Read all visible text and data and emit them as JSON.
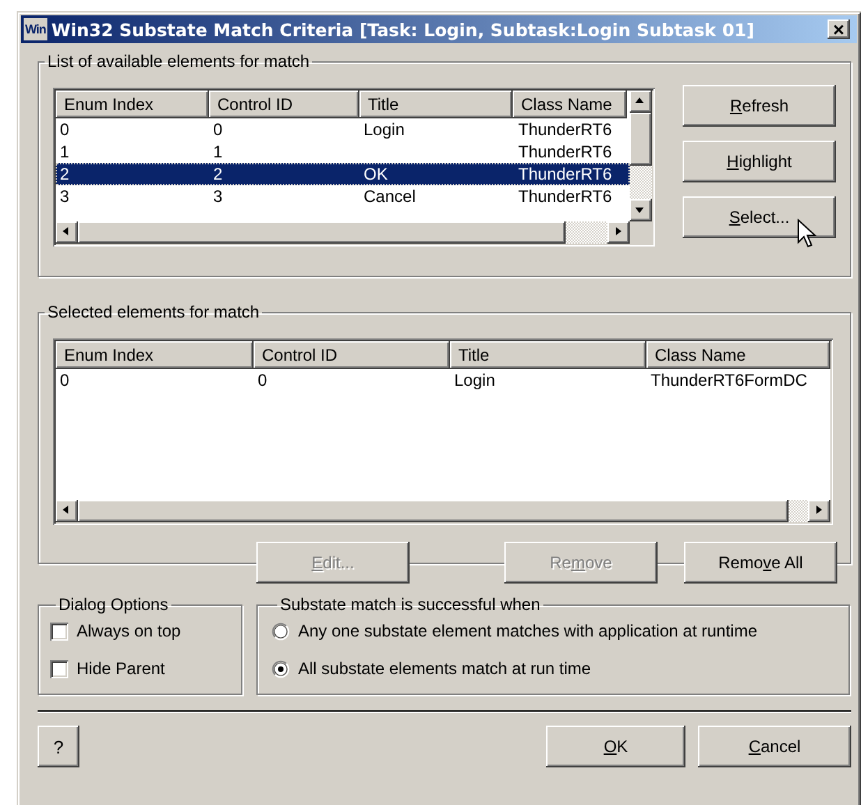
{
  "window": {
    "icon_label": "Win",
    "title": "Win32 Substate Match Criteria [Task: Login, Subtask:Login Subtask 01]",
    "close": "×"
  },
  "available": {
    "title": "List of available elements for match",
    "columns": [
      "Enum Index",
      "Control ID",
      "Title",
      "Class Name"
    ],
    "rows": [
      {
        "cells": [
          "0",
          "0",
          "Login",
          "ThunderRT6"
        ],
        "selected": false
      },
      {
        "cells": [
          "1",
          "1",
          "",
          "ThunderRT6"
        ],
        "selected": false
      },
      {
        "cells": [
          "2",
          "2",
          "OK",
          "ThunderRT6"
        ],
        "selected": true
      },
      {
        "cells": [
          "3",
          "3",
          "Cancel",
          "ThunderRT6"
        ],
        "selected": false
      }
    ],
    "buttons": [
      {
        "label": {
          "key": "R",
          "rest": "efresh"
        },
        "disabled": false
      },
      {
        "label": {
          "key": "H",
          "rest": "ighlight"
        },
        "disabled": false
      },
      {
        "label": {
          "key": "S",
          "rest": "elect..."
        },
        "disabled": false
      }
    ]
  },
  "selected_elements": {
    "title": "Selected elements for match",
    "columns": [
      "Enum Index",
      "Control ID",
      "Title",
      "Class Name"
    ],
    "rows": [
      {
        "cells": [
          "0",
          "0",
          "Login",
          "ThunderRT6FormDC"
        ],
        "selected": false
      }
    ],
    "buttons": [
      {
        "label": {
          "key": "E",
          "rest": "dit..."
        },
        "disabled": true
      },
      {
        "label": {
          "before": "Re",
          "key": "m",
          "rest": "ove"
        },
        "disabled": true
      },
      {
        "label": {
          "before": "Remo",
          "key": "v",
          "rest": "e All"
        },
        "disabled": false
      }
    ]
  },
  "dialog_options": {
    "title": "Dialog Options",
    "options": [
      {
        "label": "Always on top",
        "checked": false
      },
      {
        "label": "Hide Parent",
        "checked": false
      }
    ]
  },
  "match_condition": {
    "title": "Substate match is successful when",
    "options": [
      {
        "label": "Any one substate element matches with application at runtime",
        "selected": false
      },
      {
        "label": "All substate elements match at run time",
        "selected": true
      }
    ]
  },
  "footer": {
    "help": "?",
    "buttons": [
      {
        "label": {
          "key": "O",
          "rest": "K"
        },
        "disabled": false
      },
      {
        "label": {
          "key": "C",
          "rest": "ancel"
        },
        "disabled": false
      }
    ]
  }
}
